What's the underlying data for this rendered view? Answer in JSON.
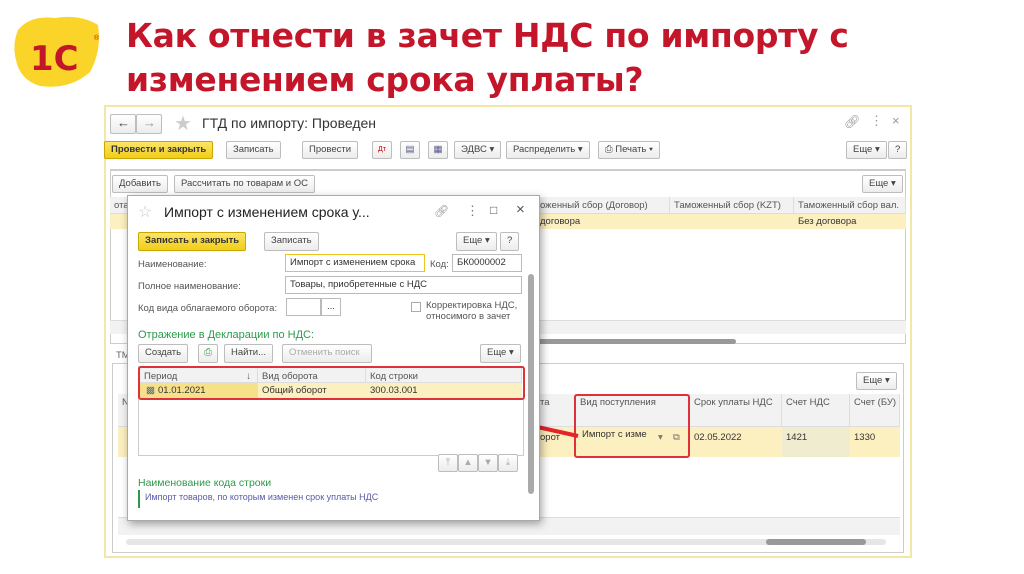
{
  "slide_title": "Как отнести в зачет НДС по импорту с изменением срока уплаты?",
  "logo_text": "1С",
  "main_window": {
    "title": "ГТД по импорту: Проведен",
    "toolbar": {
      "post_close": "Провести и закрыть",
      "save": "Записать",
      "post": "Провести",
      "edvs": "ЭДВС",
      "distribute": "Распределить",
      "print": "Печать",
      "more": "Еще",
      "help": "?"
    },
    "tab_toolbar": {
      "add": "Добавить",
      "calc": "Рассчитать по товарам и ОС",
      "more": "Еще"
    },
    "top_table": {
      "columns": [
        "ота)",
        "оженный сбор (Договор)",
        "Таможенный сбор (KZT)",
        "Таможенный сбор вал."
      ],
      "row": [
        "",
        "договора",
        "",
        "Без договора"
      ]
    },
    "bottom_tab": "ТМ",
    "bottom_more": "Еще",
    "bottom_table": {
      "columns": [
        "N",
        "та",
        "Вид поступления",
        "Срок уплаты НДС",
        "Счет НДС",
        "Счет (БУ)"
      ],
      "row": [
        "",
        "орот",
        "Импорт с изме",
        "02.05.2022",
        "1421",
        "1330"
      ]
    }
  },
  "dialog": {
    "title": "Импорт с изменением срока у...",
    "save_close": "Записать и закрыть",
    "save": "Записать",
    "more": "Еще",
    "help": "?",
    "name_label": "Наименование:",
    "name_value": "Импорт с изменением срока",
    "code_label": "Код:",
    "code_value": "БК0000002",
    "fullname_label": "Полное наименование:",
    "fullname_value": "Товары, приобретенные с НДС",
    "turnover_label": "Код вида облагаемого оборота:",
    "turnover_btn": "...",
    "correction_label_1": "Корректировка НДС,",
    "correction_label_2": "относимого в зачет",
    "section_title": "Отражение в Декларации по НДС:",
    "create": "Создать",
    "find": "Найти...",
    "cancel_search": "Отменить поиск",
    "table_more": "Еще",
    "columns": [
      "Период",
      "Вид оборота",
      "Код строки"
    ],
    "row": [
      "01.01.2021",
      "Общий оборот",
      "300.03.001"
    ],
    "code_name_title": "Наименование кода строки",
    "code_name_text": "Импорт товаров, по которым изменен срок уплаты НДС"
  }
}
